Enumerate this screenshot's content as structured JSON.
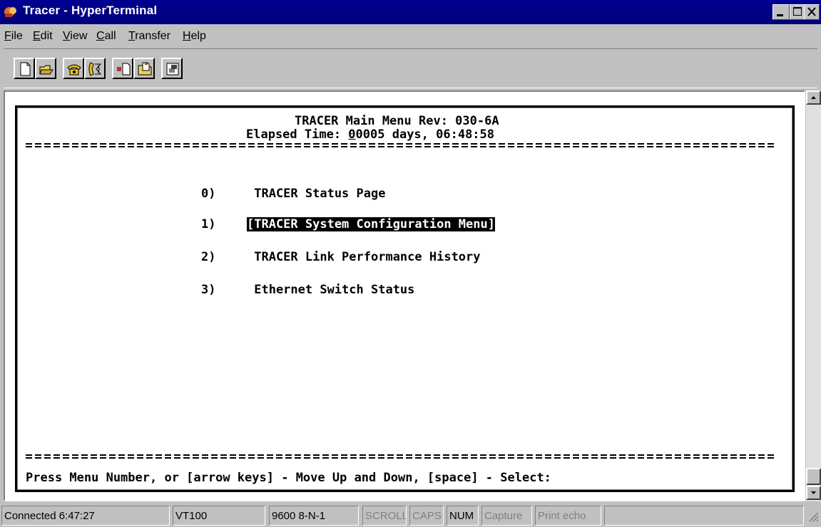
{
  "window": {
    "title": "Tracer - HyperTerminal"
  },
  "menubar": {
    "items": [
      {
        "label": "File",
        "mnemonic": "F",
        "rest": "ile"
      },
      {
        "label": "Edit",
        "mnemonic": "E",
        "rest": "dit"
      },
      {
        "label": "View",
        "mnemonic": "V",
        "rest": "iew"
      },
      {
        "label": "Call",
        "mnemonic": "C",
        "rest": "all"
      },
      {
        "label": "Transfer",
        "mnemonic": "T",
        "rest": "ransfer"
      },
      {
        "label": "Help",
        "mnemonic": "H",
        "rest": "elp"
      }
    ]
  },
  "toolbar": {
    "buttons": [
      {
        "icon": "new-document-icon"
      },
      {
        "icon": "open-folder-icon"
      },
      {
        "icon": "phone-connect-icon"
      },
      {
        "icon": "phone-disconnect-icon"
      },
      {
        "icon": "send-file-icon"
      },
      {
        "icon": "receive-file-icon"
      },
      {
        "icon": "properties-icon"
      }
    ]
  },
  "terminal": {
    "header_title": "TRACER Main Menu Rev: 030-6A",
    "elapsed_label": "Elapsed Time: ",
    "elapsed_cursor_char": "0",
    "elapsed_value": "0005 days, 06:48:58",
    "options": [
      {
        "num": "0)",
        "label": " TRACER Status Page",
        "selected": false
      },
      {
        "num": "1)",
        "label": "[TRACER System Configuration Menu]",
        "selected": true
      },
      {
        "num": "2)",
        "label": " TRACER Link Performance History",
        "selected": false
      },
      {
        "num": "3)",
        "label": " Ethernet Switch Status",
        "selected": false
      }
    ],
    "prompt": "Press Menu Number, or [arrow keys] - Move Up and Down, [space] - Select:"
  },
  "statusbar": {
    "connected": "Connected 6:47:27",
    "emulation": "VT100",
    "port_settings": "9600 8-N-1",
    "scroll": "SCROLL",
    "caps": "CAPS",
    "num": "NUM",
    "capture": "Capture",
    "print_echo": "Print echo"
  }
}
